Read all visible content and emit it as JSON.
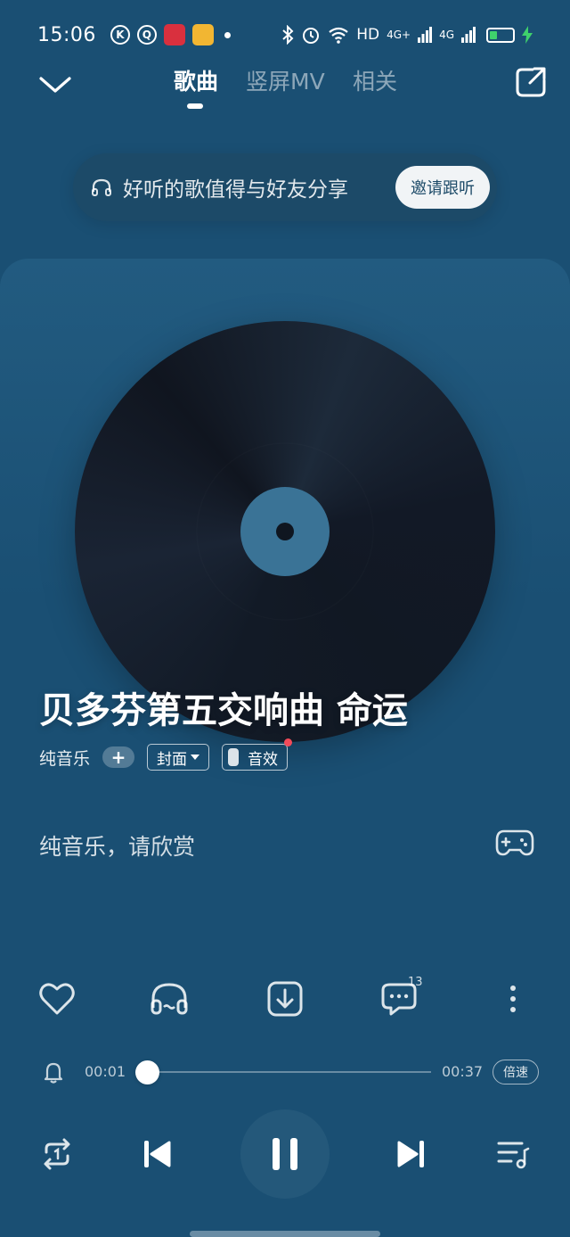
{
  "status_bar": {
    "time": "15:06",
    "network_label": "HD",
    "signal_1": "4G+",
    "signal_2": "4G",
    "battery_color": "#3fd16c"
  },
  "nav": {
    "tabs": [
      {
        "label": "歌曲",
        "active": true
      },
      {
        "label": "竖屏MV",
        "active": false
      },
      {
        "label": "相关",
        "active": false
      }
    ]
  },
  "share_banner": {
    "text": "好听的歌值得与好友分享",
    "button_label": "邀请跟听"
  },
  "song": {
    "title": "贝多芬第五交响曲 命运",
    "artist": "纯音乐",
    "follow_label": "+",
    "cover_label": "封面",
    "effect_label": "音效",
    "lyric": "纯音乐，请欣赏"
  },
  "actions": {
    "comment_count": "13",
    "icons": [
      "heart-icon",
      "listen-together-icon",
      "download-icon",
      "comment-icon",
      "more-icon"
    ]
  },
  "progress": {
    "current_time": "00:01",
    "total_time": "00:37",
    "fraction": 0.03,
    "speed_label": "倍速"
  },
  "colors": {
    "background": "#1a4f73",
    "accent_red": "#f24a59",
    "disc_label": "#3a7396"
  }
}
